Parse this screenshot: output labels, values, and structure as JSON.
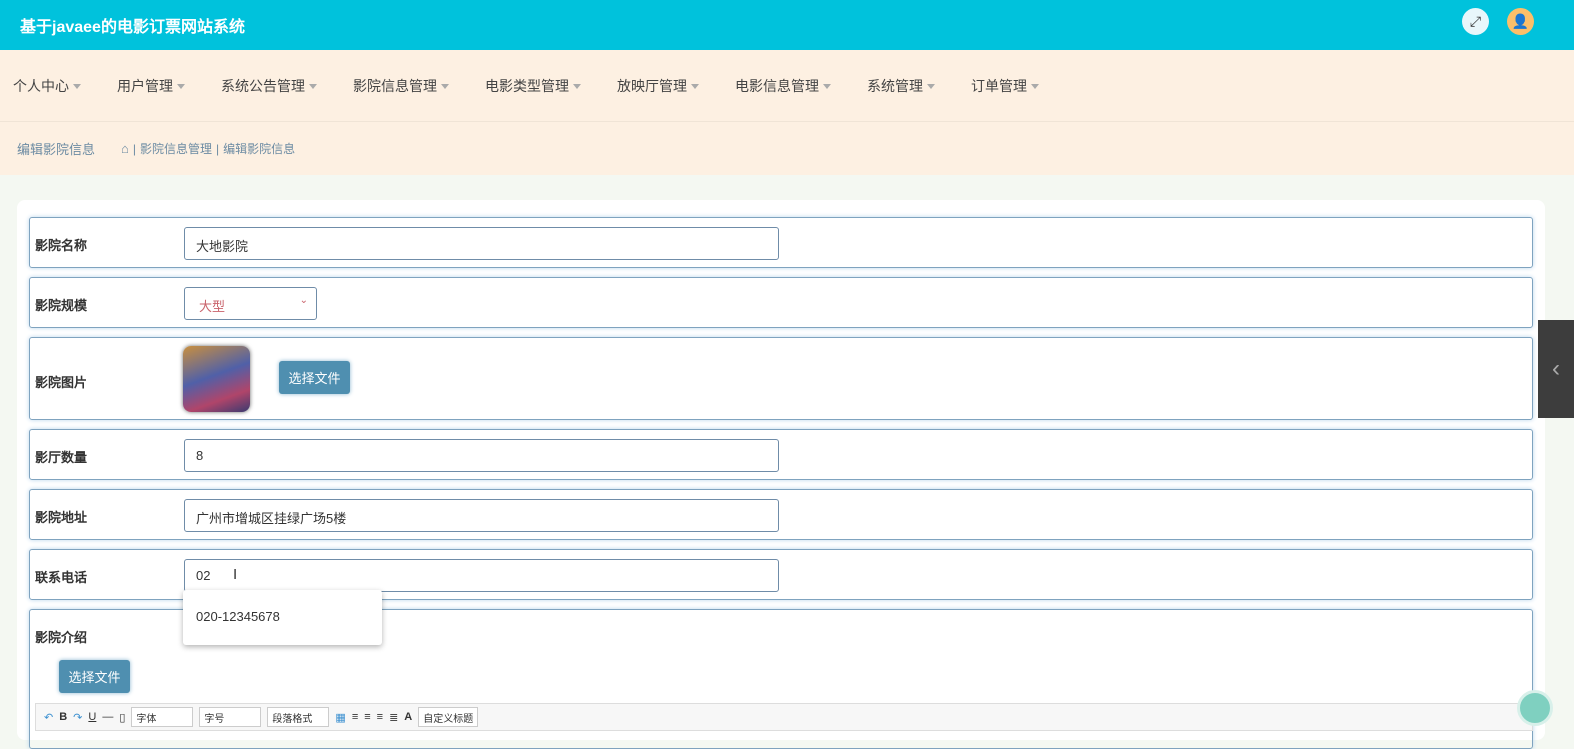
{
  "header": {
    "title": "基于javaee的电影订票网站系统"
  },
  "nav": [
    "个人中心",
    "用户管理",
    "系统公告管理",
    "影院信息管理",
    "电影类型管理",
    "放映厅管理",
    "电影信息管理",
    "系统管理",
    "订单管理"
  ],
  "breadcrumb": {
    "page_title": "编辑影院信息",
    "items": [
      "影院信息管理",
      "编辑影院信息"
    ],
    "sep": "|"
  },
  "form": {
    "name_label": "影院名称",
    "name_value": "大地影院",
    "scale_label": "影院规模",
    "scale_value": "大型",
    "image_label": "影院图片",
    "choose_file": "选择文件",
    "halls_label": "影厅数量",
    "halls_value": "8",
    "address_label": "影院地址",
    "address_value": "广州市增城区挂绿广场5楼",
    "phone_label": "联系电话",
    "phone_value": "02",
    "phone_suggestion": "020-12345678",
    "intro_label": "影院介绍",
    "intro_choose_file": "选择文件"
  },
  "editor": {
    "font": "字体",
    "size": "字号",
    "paragraph": "段落格式",
    "custom_title": "自定义标题",
    "bold": "B",
    "underline": "U",
    "color": "A"
  },
  "colors": {
    "header": "#00c2dc",
    "nav": "#fdf0e2",
    "button": "#4f8fb0"
  }
}
